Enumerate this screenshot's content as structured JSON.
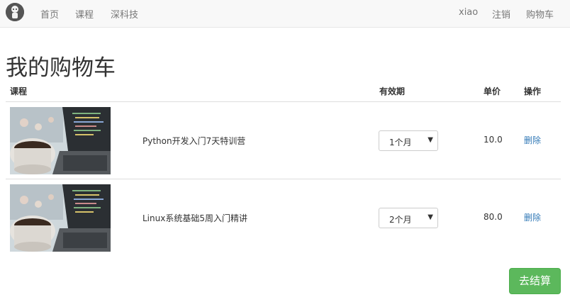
{
  "navbar": {
    "left_links": [
      "首页",
      "课程",
      "深科技"
    ],
    "right_links": [
      "xiao",
      "注销",
      "购物车"
    ]
  },
  "page": {
    "title": "我的购物车"
  },
  "table": {
    "headers": [
      "课程",
      "有效期",
      "单价",
      "操作"
    ],
    "rows": [
      {
        "name": "Python开发入门7天特训营",
        "period": "1个月",
        "price": "10.0",
        "action": "删除"
      },
      {
        "name": "Linux系统基础5周入门精讲",
        "period": "2个月",
        "price": "80.0",
        "action": "删除"
      }
    ]
  },
  "checkout_label": "去结算",
  "colors": {
    "link": "#337ab7",
    "checkout": "#5cb85c",
    "nav_bg": "#f8f8f8"
  },
  "icons": {
    "logo": "avatar-logo-icon",
    "dropdown": "dropdown-arrow-icon"
  }
}
